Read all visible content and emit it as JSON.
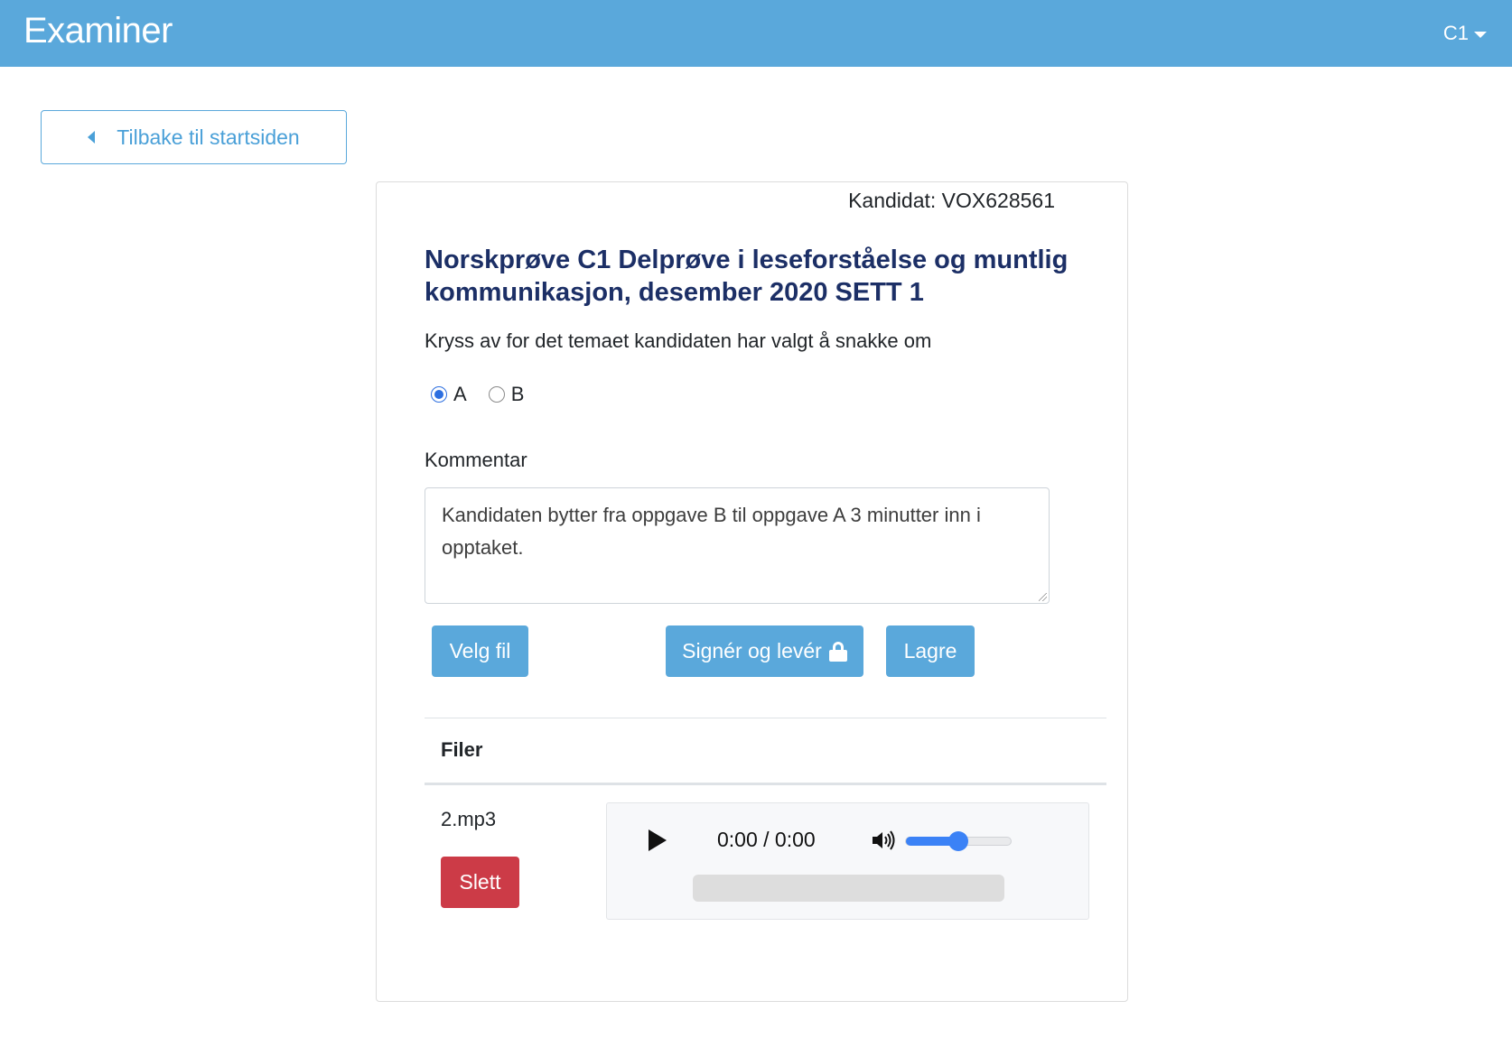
{
  "navbar": {
    "brand": "Examiner",
    "user_menu": "C1"
  },
  "back_button": {
    "label": "Tilbake til startsiden"
  },
  "card": {
    "candidate": "Kandidat: VOX628561",
    "title": "Norskprøve C1 Delprøve i leseforståelse og muntlig kommunikasjon, desember 2020 SETT 1",
    "instruction": "Kryss av for det temaet kandidaten har valgt å snakke om",
    "topic_options": [
      {
        "label": "A",
        "checked": true
      },
      {
        "label": "B",
        "checked": false
      }
    ],
    "comment_label": "Kommentar",
    "comment_value": "Kandidaten bytter fra oppgave B til oppgave A 3 minutter inn i opptaket.",
    "buttons": {
      "choose_file": "Velg fil",
      "sign_submit": "Signér og levér",
      "save": "Lagre"
    },
    "files": {
      "header": "Filer",
      "items": [
        {
          "name": "2.mp3",
          "delete_label": "Slett",
          "player": {
            "time": "0:00 / 0:00",
            "volume": 0.5,
            "progress": 0
          }
        }
      ]
    }
  },
  "colors": {
    "navbar": "#5aa8db",
    "primary_button": "#5aa8db",
    "danger_button": "#cc3b47",
    "title": "#1c2f66",
    "slider": "#3b82f6"
  }
}
